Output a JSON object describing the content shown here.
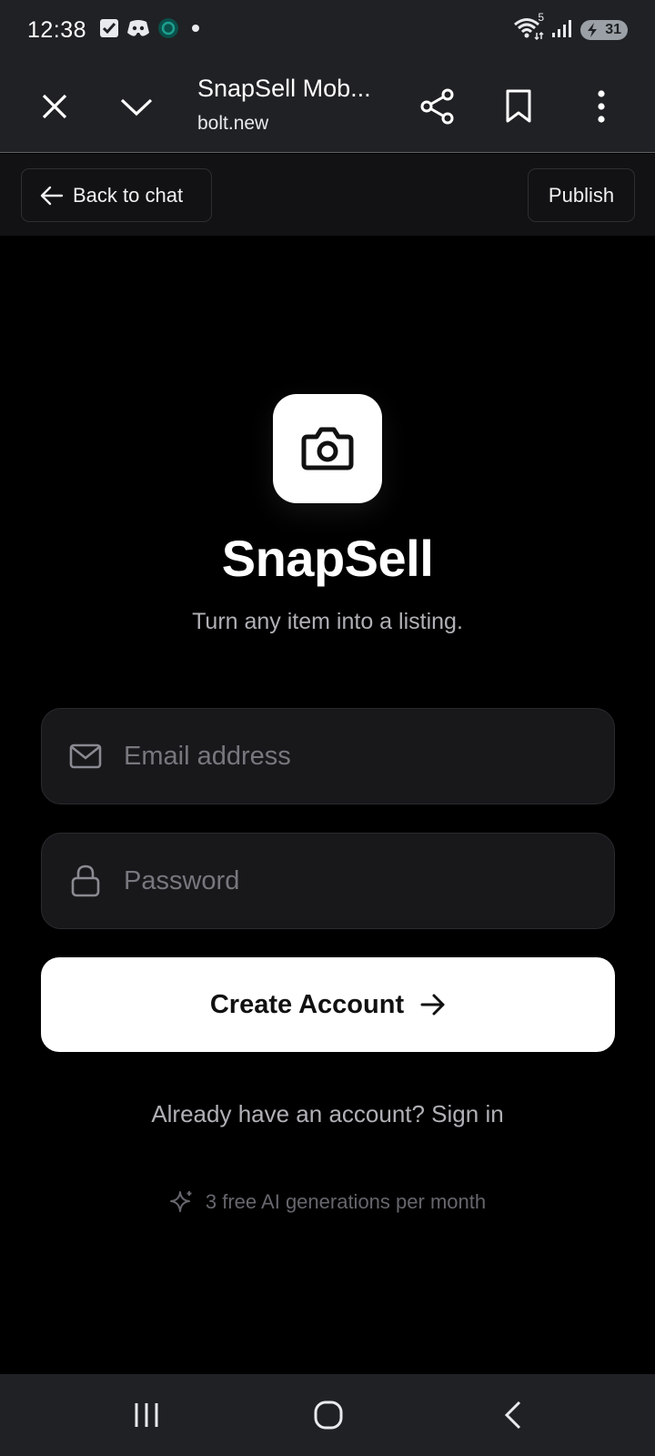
{
  "status_bar": {
    "time": "12:38",
    "wifi_badge": "5",
    "battery": "31",
    "icons": [
      "checkbox-icon",
      "discord-icon",
      "app-icon",
      "dot-icon",
      "wifi-icon",
      "signal-icon",
      "battery-icon"
    ]
  },
  "browser": {
    "tab_title": "SnapSell Mob...",
    "url": "bolt.new",
    "icons": [
      "close-icon",
      "chevron-down-icon",
      "share-icon",
      "bookmark-icon",
      "more-vert-icon"
    ]
  },
  "app_header": {
    "back_label": "Back to chat",
    "publish_label": "Publish"
  },
  "main": {
    "app_name": "SnapSell",
    "tagline": "Turn any item into a listing.",
    "email_placeholder": "Email address",
    "password_placeholder": "Password",
    "create_label": "Create Account",
    "signin_text": "Already have an account? Sign in",
    "free_note": "3 free AI generations per month"
  },
  "colors": {
    "background": "#000000",
    "browser_chrome": "#202124",
    "field_bg": "#18181b",
    "button_bg": "#ffffff",
    "muted_text": "#b0b0b6"
  }
}
